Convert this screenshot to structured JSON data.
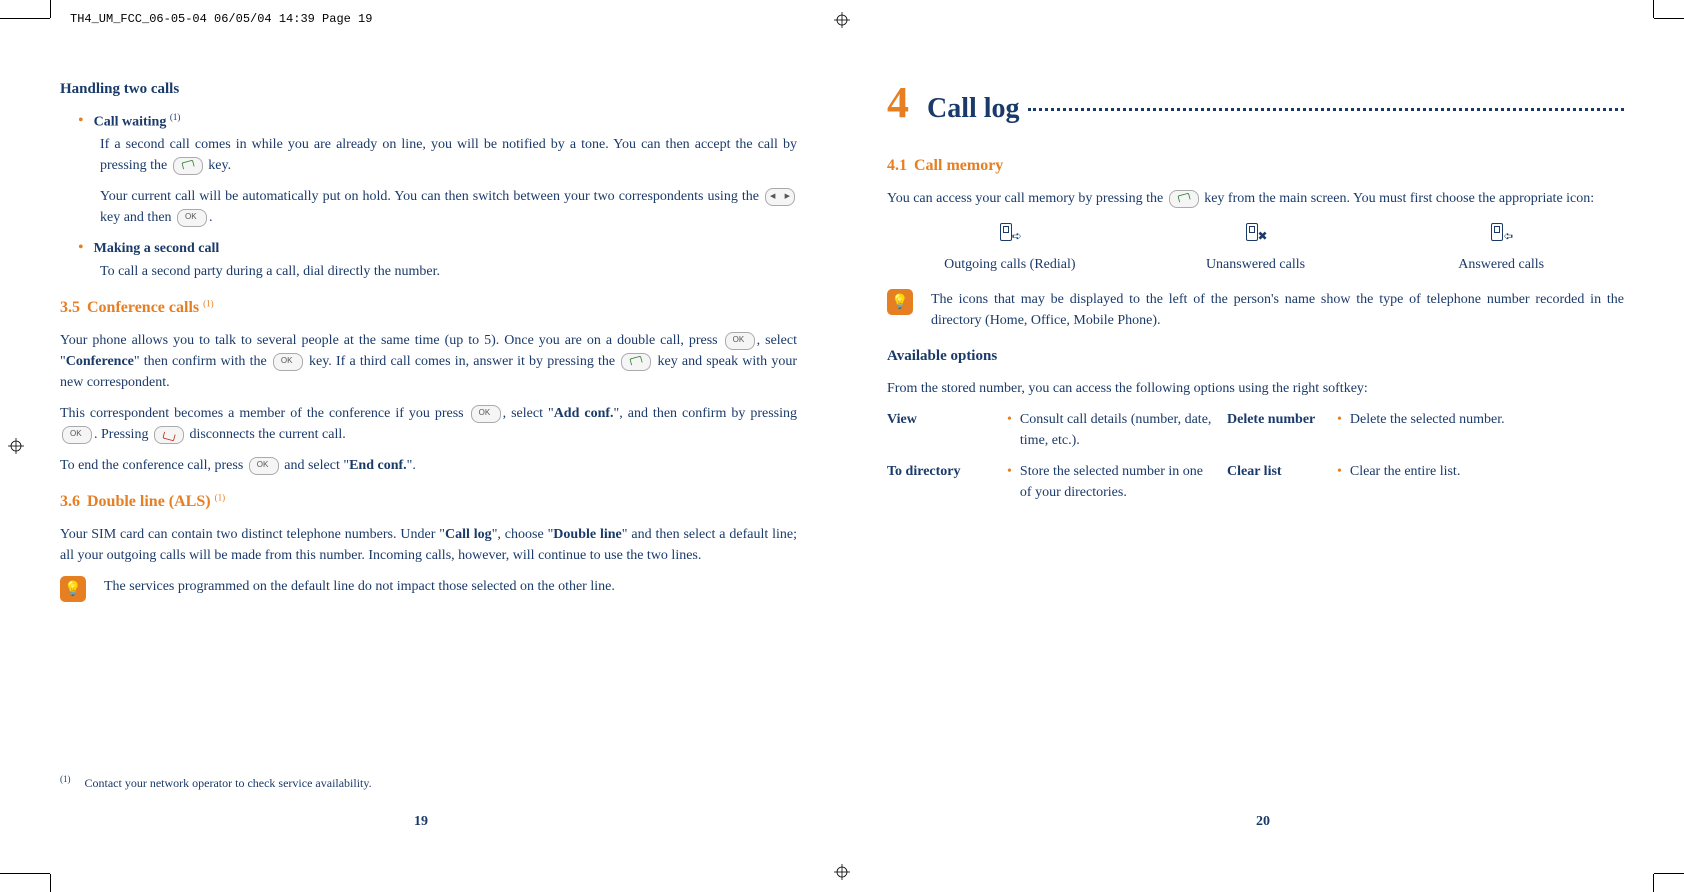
{
  "header": "TH4_UM_FCC_06-05-04  06/05/04  14:39  Page 19",
  "left": {
    "h1": "Handling two calls",
    "cw_title": "Call waiting ",
    "cw_sup": "(1)",
    "cw_p1a": "If a second call comes in while you are already on line, you will be notified by a tone. You can then accept the call by pressing the ",
    "cw_p1b": " key.",
    "cw_p2a": "Your current call will be automatically put on hold. You can then switch between your two correspondents using the ",
    "cw_p2b": " key and then ",
    "cw_p2c": ".",
    "msc_title": "Making a second call",
    "msc_body": "To call a second party during a call, dial directly the number.",
    "s35_num": "3.5",
    "s35_title": "Conference calls ",
    "s35_sup": "(1)",
    "s35_p1a": "Your phone allows you to talk to several people at the same time (up to 5). Once you are on a double call, press ",
    "s35_p1b": ", select \"",
    "s35_p1c": "Conference",
    "s35_p1d": "\" then confirm with the ",
    "s35_p1e": " key. If a third call comes in, answer it by pressing the ",
    "s35_p1f": " key and speak with your new correspondent.",
    "s35_p2a": "This correspondent becomes a member of the conference if you press ",
    "s35_p2b": ", select \"",
    "s35_p2c": "Add conf.",
    "s35_p2d": "\", and then confirm by pressing ",
    "s35_p2e": ". Pressing ",
    "s35_p2f": " disconnects the current call.",
    "s35_p3a": "To end the conference call, press ",
    "s35_p3b": " and select \"",
    "s35_p3c": "End conf.",
    "s35_p3d": "\".",
    "s36_num": "3.6",
    "s36_title": "Double line (ALS) ",
    "s36_sup": "(1)",
    "s36_p1a": "Your SIM card can contain two distinct telephone numbers. Under \"",
    "s36_p1b": "Call log",
    "s36_p1c": "\", choose \"",
    "s36_p1d": "Double line",
    "s36_p1e": "\" and then select a default line; all your outgoing calls will be made from this number. Incoming calls, however, will continue to use the two lines.",
    "tip": "The services programmed on the default line do not impact those selected on the other line.",
    "footnote_sup": "(1)",
    "footnote": "Contact your network operator to check service availability.",
    "pagenum": "19"
  },
  "right": {
    "chapnum": "4",
    "chaptitle": "Call log",
    "s41_num": "4.1",
    "s41_title": "Call memory",
    "s41_p1a": "You can access your call memory by pressing the ",
    "s41_p1b": " key from the main screen. You must first choose the appropriate icon:",
    "icon1": "Outgoing calls (Redial)",
    "icon2": "Unanswered calls",
    "icon3": "Answered calls",
    "tip": "The icons that may be displayed to the left of the person's name show the type of telephone number recorded in the directory (Home, Office, Mobile Phone).",
    "avail": "Available options",
    "avail_intro": "From the stored number, you can access the following options using the right softkey:",
    "opt_view": "View",
    "opt_view_desc": "Consult call details (number, date, time, etc.).",
    "opt_todir": "To directory",
    "opt_todir_desc": "Store the selected number in one of your directories.",
    "opt_delnum": "Delete number",
    "opt_delnum_desc": "Delete the selected number.",
    "opt_clear": "Clear list",
    "opt_clear_desc": "Clear the entire list.",
    "pagenum": "20"
  }
}
